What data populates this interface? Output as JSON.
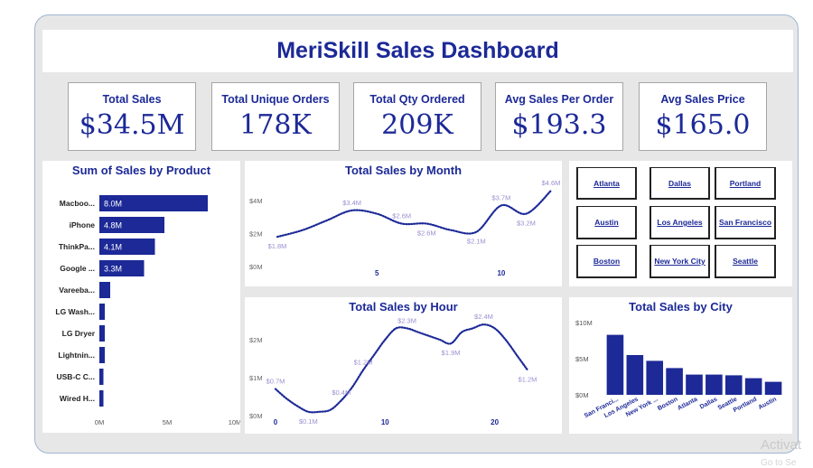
{
  "title": "MeriSkill Sales Dashboard",
  "kpis": [
    {
      "label": "Total Sales",
      "value": "$34.5M"
    },
    {
      "label": "Total Unique Orders",
      "value": "178K"
    },
    {
      "label": "Total Qty Ordered",
      "value": "209K"
    },
    {
      "label": "Avg Sales Per Order",
      "value": "$193.3"
    },
    {
      "label": "Avg Sales Price",
      "value": "$165.0"
    }
  ],
  "slicer": {
    "items": [
      "Atlanta",
      "Dallas",
      "Portland",
      "Austin",
      "Los Angeles",
      "San Francisco",
      "Boston",
      "New York City",
      "Seattle"
    ]
  },
  "colors": {
    "accent": "#1c2997",
    "line": "#1c2997",
    "label": "#9c8fd0"
  },
  "watermark": {
    "line1": "Activat",
    "line2": "Go to Se"
  },
  "chart_data": [
    {
      "type": "bar",
      "orientation": "horizontal",
      "title": "Sum of Sales by Product",
      "categories": [
        "Macboo...",
        "iPhone",
        "ThinkPa...",
        "Google ...",
        "Vareeba...",
        "LG Wash...",
        "LG Dryer",
        "Lightnin...",
        "USB-C C...",
        "Wired H..."
      ],
      "values": [
        8.0,
        4.8,
        4.1,
        3.3,
        0.8,
        0.4,
        0.4,
        0.4,
        0.3,
        0.3
      ],
      "data_labels": [
        "8.0M",
        "4.8M",
        "4.1M",
        "3.3M",
        "",
        "",
        "",
        "",
        "",
        ""
      ],
      "x_ticks": [
        "0M",
        "5M",
        "10M"
      ],
      "x_tick_values": [
        0,
        5,
        10
      ],
      "xlim": [
        0,
        10
      ]
    },
    {
      "type": "line",
      "title": "Total Sales by Month",
      "x": [
        1,
        2,
        3,
        4,
        5,
        6,
        7,
        8,
        9,
        10,
        11,
        12
      ],
      "values": [
        1.8,
        2.2,
        2.8,
        3.4,
        3.2,
        2.6,
        2.6,
        2.2,
        2.1,
        3.7,
        3.2,
        4.6
      ],
      "labeled_points": [
        {
          "x": 1,
          "label": "$1.8M"
        },
        {
          "x": 4,
          "label": "$3.4M"
        },
        {
          "x": 6,
          "label": "$2.6M"
        },
        {
          "x": 7,
          "label": "$2.6M"
        },
        {
          "x": 9,
          "label": "$2.1M"
        },
        {
          "x": 10,
          "label": "$3.7M"
        },
        {
          "x": 11,
          "label": "$3.2M"
        },
        {
          "x": 12,
          "label": "$4.6M"
        }
      ],
      "y_ticks": [
        "$0M",
        "$2M",
        "$4M"
      ],
      "y_tick_values": [
        0,
        2,
        4
      ],
      "x_ticks": [
        "5",
        "10"
      ],
      "x_tick_values": [
        5,
        10
      ],
      "ylim": [
        0,
        4.6
      ]
    },
    {
      "type": "line",
      "title": "Total Sales by Hour",
      "x": [
        0,
        1,
        2,
        3,
        4,
        5,
        6,
        7,
        8,
        9,
        10,
        11,
        12,
        13,
        14,
        15,
        16,
        17,
        18,
        19,
        20,
        21,
        22,
        23
      ],
      "values": [
        0.7,
        0.45,
        0.25,
        0.1,
        0.1,
        0.15,
        0.4,
        0.75,
        1.2,
        1.6,
        2.0,
        2.3,
        2.3,
        2.2,
        2.1,
        2.0,
        1.9,
        2.2,
        2.3,
        2.4,
        2.3,
        2.0,
        1.6,
        1.2
      ],
      "labeled_points": [
        {
          "x": 0,
          "label": "$0.7M"
        },
        {
          "x": 3,
          "label": "$0.1M"
        },
        {
          "x": 6,
          "label": "$0.4M"
        },
        {
          "x": 8,
          "label": "$1.2M"
        },
        {
          "x": 12,
          "label": "$2.3M"
        },
        {
          "x": 16,
          "label": "$1.9M"
        },
        {
          "x": 19,
          "label": "$2.4M"
        },
        {
          "x": 23,
          "label": "$1.2M"
        }
      ],
      "y_ticks": [
        "$0M",
        "$1M",
        "$2M"
      ],
      "y_tick_values": [
        0,
        1,
        2
      ],
      "x_ticks": [
        "0",
        "10",
        "20"
      ],
      "x_tick_values": [
        0,
        10,
        20
      ],
      "ylim": [
        0,
        2.5
      ]
    },
    {
      "type": "bar",
      "title": "Total Sales by City",
      "categories": [
        "San Franci...",
        "Los Angeles",
        "New York ...",
        "Boston",
        "Atlanta",
        "Dallas",
        "Seattle",
        "Portland",
        "Austin"
      ],
      "values": [
        8.3,
        5.5,
        4.7,
        3.7,
        2.8,
        2.8,
        2.7,
        2.3,
        1.8
      ],
      "y_ticks": [
        "$0M",
        "$5M",
        "$10M"
      ],
      "y_tick_values": [
        0,
        5,
        10
      ],
      "ylim": [
        0,
        10
      ]
    }
  ]
}
